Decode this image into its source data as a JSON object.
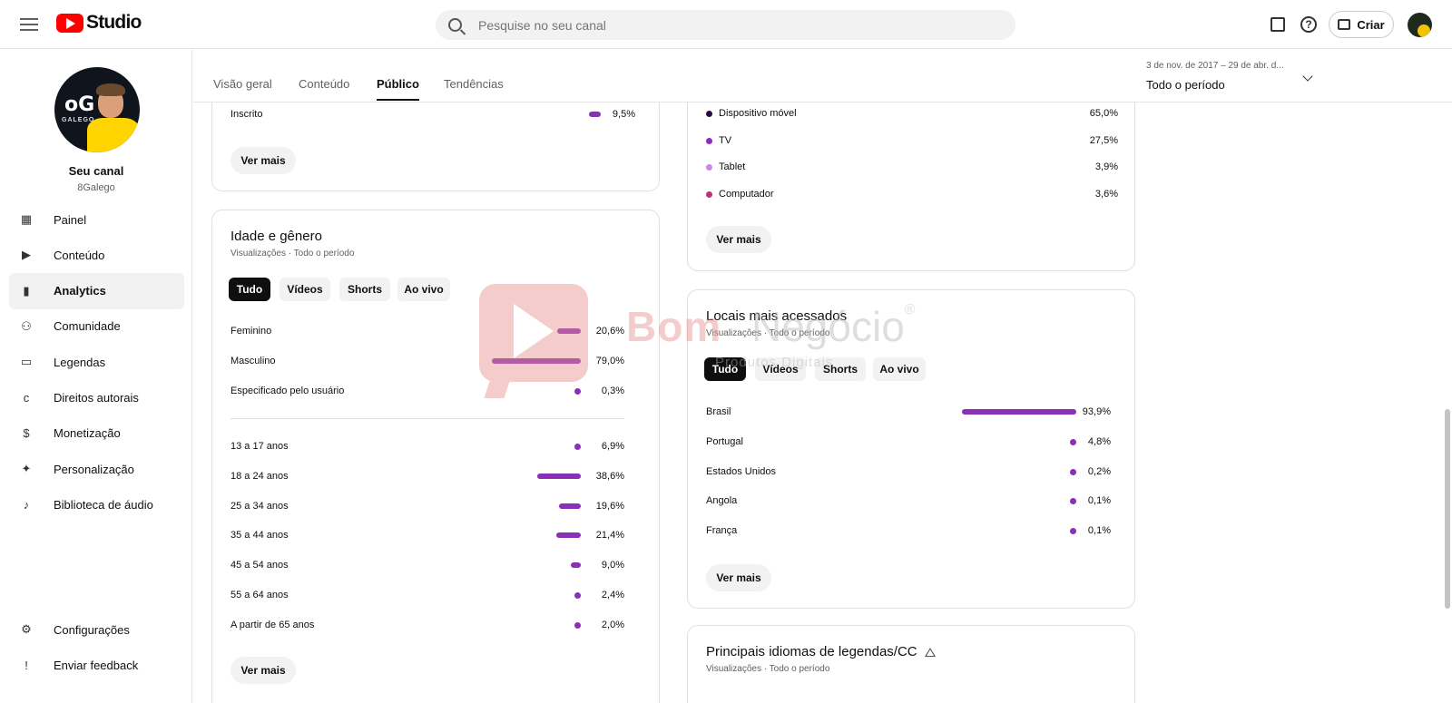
{
  "header": {
    "logo_text": "Studio",
    "search_placeholder": "Pesquise no seu canal",
    "criar_label": "Criar",
    "help_glyph": "?"
  },
  "icons": {
    "menu": "hamburger-icon",
    "search": "search-icon",
    "feedback": "feedback-icon",
    "help": "help-icon",
    "create": "video-camera-plus-icon"
  },
  "channel": {
    "avatar_text_main": "oG",
    "avatar_text_sub": "GALEGO",
    "name": "Seu canal",
    "handle": "8Galego"
  },
  "sidebar": {
    "items": [
      {
        "label": "Painel",
        "icon": "dashboard-icon",
        "glyph": "▦"
      },
      {
        "label": "Conteúdo",
        "icon": "content-icon",
        "glyph": "▶"
      },
      {
        "label": "Analytics",
        "icon": "analytics-icon",
        "glyph": "▮",
        "active": true
      },
      {
        "label": "Comunidade",
        "icon": "community-icon",
        "glyph": "⚇"
      },
      {
        "label": "Legendas",
        "icon": "subtitles-icon",
        "glyph": "▭"
      },
      {
        "label": "Direitos autorais",
        "icon": "copyright-icon",
        "glyph": "c"
      },
      {
        "label": "Monetização",
        "icon": "monetization-icon",
        "glyph": "$"
      },
      {
        "label": "Personalização",
        "icon": "customization-icon",
        "glyph": "✦"
      },
      {
        "label": "Biblioteca de áudio",
        "icon": "audio-library-icon",
        "glyph": "♪"
      }
    ],
    "bottom": [
      {
        "label": "Configurações",
        "icon": "settings-icon",
        "glyph": "⚙"
      },
      {
        "label": "Enviar feedback",
        "icon": "send-feedback-icon",
        "glyph": "!"
      }
    ]
  },
  "tabs": {
    "items": [
      "Visão geral",
      "Conteúdo",
      "Público",
      "Tendências"
    ],
    "active_index": 2
  },
  "period": {
    "range": "3 de nov. de 2017 – 29 de abr. d...",
    "label": "Todo o período"
  },
  "subscriber_card": {
    "row_label": "Inscrito",
    "row_value": "9,5%",
    "row_fraction": 0.095,
    "ver_mais": "Ver mais"
  },
  "device_card": {
    "rows": [
      {
        "label": "Dispositivo móvel",
        "value": "65,0%",
        "color": "#2b0a3d"
      },
      {
        "label": "TV",
        "value": "27,5%",
        "color": "#8c2fb7"
      },
      {
        "label": "Tablet",
        "value": "3,9%",
        "color": "#d083e8"
      },
      {
        "label": "Computador",
        "value": "3,6%",
        "color": "#c0307a"
      }
    ],
    "ver_mais": "Ver mais"
  },
  "age_gender_card": {
    "title": "Idade e gênero",
    "subtitle": "Visualizações · Todo o período",
    "chips": [
      "Tudo",
      "Vídeos",
      "Shorts",
      "Ao vivo"
    ],
    "gender": [
      {
        "label": "Feminino",
        "value": "20,6%",
        "fraction": 0.206
      },
      {
        "label": "Masculino",
        "value": "79,0%",
        "fraction": 0.79
      },
      {
        "label": "Especificado pelo usuário",
        "value": "0,3%",
        "fraction": 0.003
      }
    ],
    "age": [
      {
        "label": "13 a 17 anos",
        "value": "6,9%",
        "fraction": 0.069
      },
      {
        "label": "18 a 24 anos",
        "value": "38,6%",
        "fraction": 0.386
      },
      {
        "label": "25 a 34 anos",
        "value": "19,6%",
        "fraction": 0.196
      },
      {
        "label": "35 a 44 anos",
        "value": "21,4%",
        "fraction": 0.214
      },
      {
        "label": "45 a 54 anos",
        "value": "9,0%",
        "fraction": 0.09
      },
      {
        "label": "55 a 64 anos",
        "value": "2,4%",
        "fraction": 0.024
      },
      {
        "label": "A partir de 65 anos",
        "value": "2,0%",
        "fraction": 0.02
      }
    ],
    "ver_mais": "Ver mais"
  },
  "locations_card": {
    "title": "Locais mais acessados",
    "subtitle": "Visualizações · Todo o período",
    "chips": [
      "Tudo",
      "Vídeos",
      "Shorts",
      "Ao vivo"
    ],
    "rows": [
      {
        "label": "Brasil",
        "value": "93,9%",
        "fraction": 0.939
      },
      {
        "label": "Portugal",
        "value": "4,8%",
        "fraction": 0.048
      },
      {
        "label": "Estados Unidos",
        "value": "0,2%",
        "fraction": 0.002
      },
      {
        "label": "Angola",
        "value": "0,1%",
        "fraction": 0.001
      },
      {
        "label": "França",
        "value": "0,1%",
        "fraction": 0.001
      }
    ],
    "ver_mais": "Ver mais"
  },
  "languages_card": {
    "title": "Principais idiomas de legendas/CC",
    "subtitle": "Visualizações · Todo o período"
  },
  "watermark": {
    "brand_a": "Bom",
    "brand_b": "Negócio",
    "tagline": "Produtos Digitais",
    "mark": "®"
  },
  "colors": {
    "bar": "#8c2fb7",
    "brand_red": "#ff0000"
  }
}
